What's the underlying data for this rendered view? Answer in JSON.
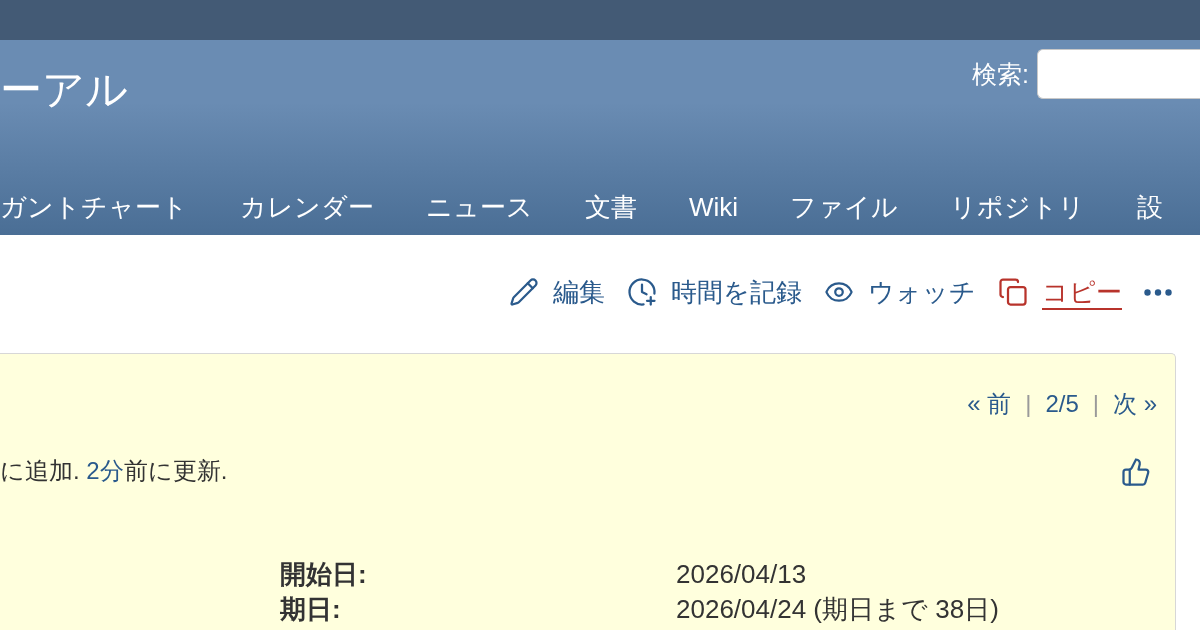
{
  "header": {
    "title": "ーアル",
    "search": {
      "label": "検索:"
    }
  },
  "main_menu": [
    {
      "label": "ガントチャート",
      "selected": false
    },
    {
      "label": "カレンダー",
      "selected": false
    },
    {
      "label": "ニュース",
      "selected": false
    },
    {
      "label": "文書",
      "selected": false
    },
    {
      "label": "Wiki",
      "selected": false
    },
    {
      "label": "ファイル",
      "selected": false
    },
    {
      "label": "リポジトリ",
      "selected": false
    },
    {
      "label": "設",
      "selected": false
    }
  ],
  "actions": [
    {
      "kind": "edit",
      "label": "編集",
      "hovered": false
    },
    {
      "kind": "log_time",
      "label": "時間を記録",
      "hovered": false
    },
    {
      "kind": "watch",
      "label": "ウォッチ",
      "hovered": false
    },
    {
      "kind": "copy",
      "label": "コピー",
      "hovered": true
    }
  ],
  "issue": {
    "pager": [
      {
        "kind": "link",
        "text": "« 前"
      },
      {
        "kind": "separator",
        "text": "|"
      },
      {
        "kind": "link",
        "text": "2/5"
      },
      {
        "kind": "separator",
        "text": "|"
      },
      {
        "kind": "link",
        "text": "次 »"
      }
    ],
    "byline": {
      "text_before": "に追加. ",
      "link": "2分",
      "text_after": "前に更新."
    },
    "attributes": [
      {
        "label": "開始日:",
        "value": "2026/04/13"
      },
      {
        "label": "期日:",
        "value": "2026/04/24 (期日まで 38日)"
      }
    ]
  }
}
